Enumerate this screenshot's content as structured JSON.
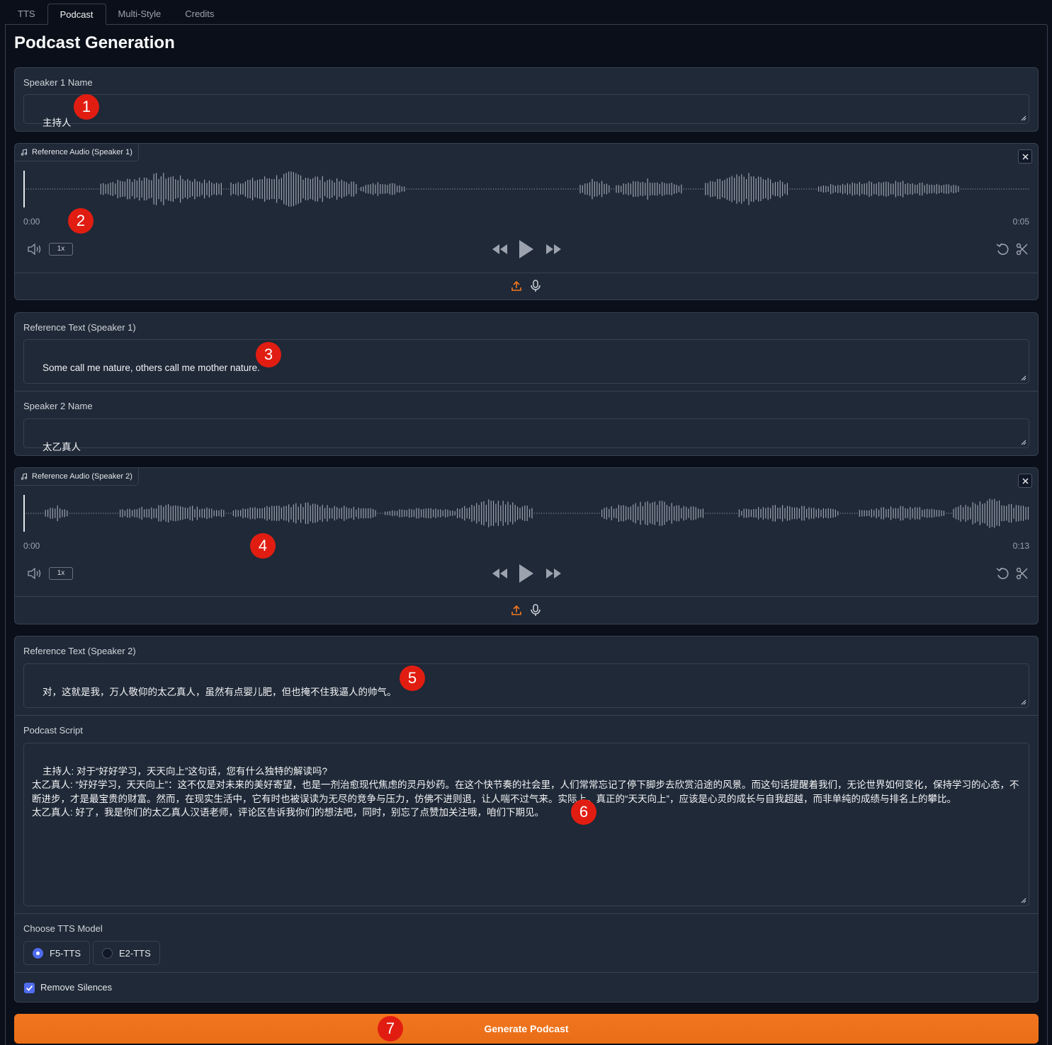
{
  "tabs": [
    "TTS",
    "Podcast",
    "Multi-Style",
    "Credits"
  ],
  "active_tab": "Podcast",
  "page_title": "Podcast Generation",
  "speaker1": {
    "name_label": "Speaker 1 Name",
    "name_value": "主持人",
    "audio_label": "Reference Audio (Speaker 1)",
    "time_start": "0:00",
    "time_end": "0:05",
    "rate": "1x",
    "ref_text_label": "Reference Text (Speaker 1)",
    "ref_text_value": "Some call me nature, others call me mother nature."
  },
  "speaker2": {
    "name_label": "Speaker 2 Name",
    "name_value": "太乙真人",
    "audio_label": "Reference Audio (Speaker 2)",
    "time_start": "0:00",
    "time_end": "0:13",
    "rate": "1x",
    "ref_text_label": "Reference Text (Speaker 2)",
    "ref_text_value": "对，这就是我，万人敬仰的太乙真人，虽然有点婴儿肥，但也掩不住我逼人的帅气。"
  },
  "podcast_script": {
    "label": "Podcast Script",
    "value": "主持人: 对于“好好学习，天天向上”这句话，您有什么独特的解读吗?\n太乙真人: “好好学习，天天向上”：这不仅是对未来的美好寄望，也是一剂治愈现代焦虑的灵丹妙药。在这个快节奏的社会里，人们常常忘记了停下脚步去欣赏沿途的风景。而这句话提醒着我们，无论世界如何变化，保持学习的心态，不断进步，才是最宝贵的财富。然而，在现实生活中，它有时也被误读为无尽的竞争与压力，仿佛不进则退，让人喘不过气来。实际上，真正的“天天向上”，应该是心灵的成长与自我超越，而非单纯的成绩与排名上的攀比。\n太乙真人: 好了，我是你们的太乙真人汉语老师，评论区告诉我你们的想法吧，同时，别忘了点赞加关注哦，咱们下期见。"
  },
  "tts_model": {
    "label": "Choose TTS Model",
    "options": [
      "F5-TTS",
      "E2-TTS"
    ],
    "selected": "F5-TTS"
  },
  "remove_silences": {
    "label": "Remove Silences",
    "checked": true
  },
  "generate_button": "Generate Podcast",
  "markers": [
    "1",
    "2",
    "3",
    "4",
    "5",
    "6",
    "7"
  ],
  "colors": {
    "accent": "#f2761f",
    "background": "#0b0f19",
    "block": "#1f2937",
    "radio": "#4f6bed",
    "marker": "#e11d12"
  }
}
